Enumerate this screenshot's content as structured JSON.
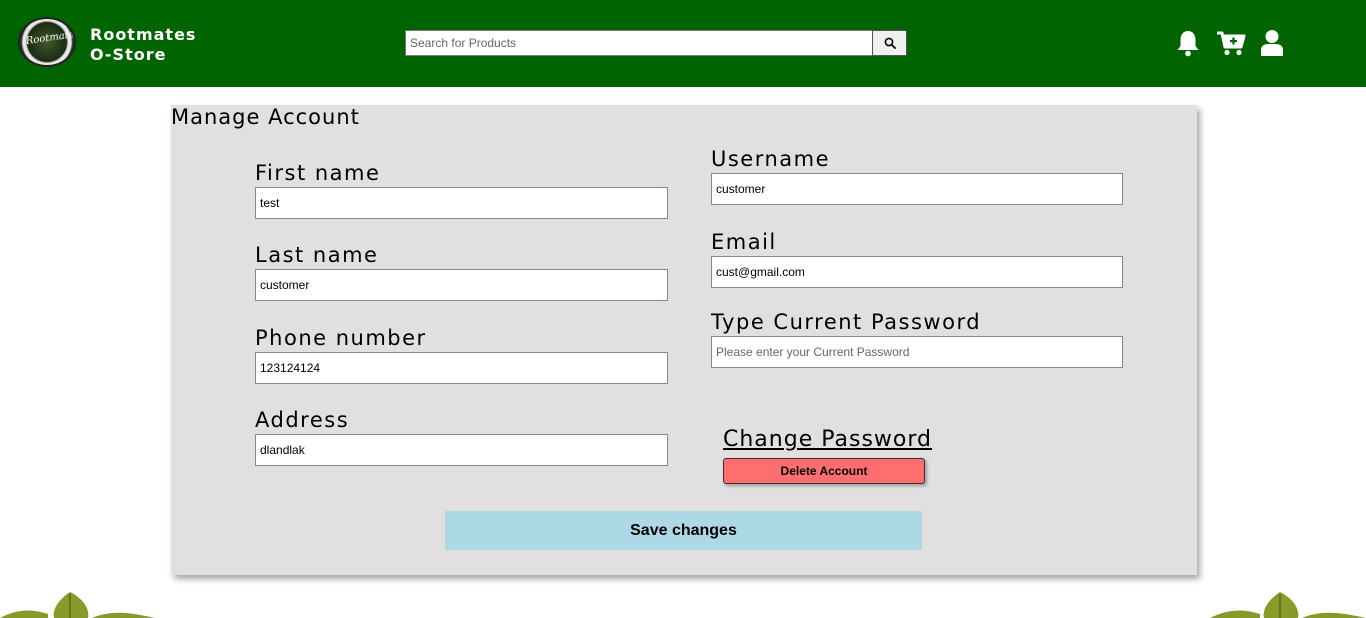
{
  "header": {
    "logo_text": "Rootmates",
    "brand_line1": "Rootmates",
    "brand_line2": "O-Store",
    "search_placeholder": "Search for Products",
    "icons": [
      "search-icon",
      "bell-icon",
      "cart-plus-icon",
      "user-icon"
    ],
    "bg_color": "#006400"
  },
  "account": {
    "title": "Manage Account",
    "fields": {
      "first_name": {
        "label": "First name",
        "value": "test"
      },
      "last_name": {
        "label": "Last name",
        "value": "customer"
      },
      "phone": {
        "label": "Phone number",
        "value": "123124124"
      },
      "address": {
        "label": "Address",
        "value": "dlandlak"
      },
      "username": {
        "label": "Username",
        "value": "customer"
      },
      "email": {
        "label": "Email",
        "value": "cust@gmail.com"
      },
      "current_password": {
        "label": "Type Current Password",
        "value": "",
        "placeholder": "Please enter your Current Password"
      }
    },
    "change_password_link": "Change Password",
    "delete_button": "Delete Account",
    "save_button": "Save changes",
    "colors": {
      "delete": "#ff6e6e",
      "save": "#add8e6",
      "panel": "#e1dfdf"
    }
  }
}
